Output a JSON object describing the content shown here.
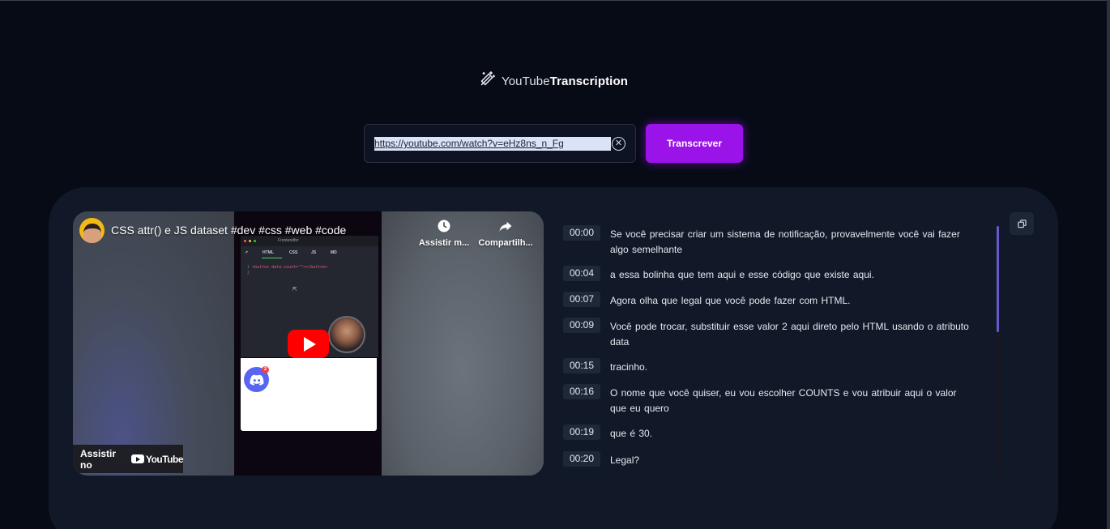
{
  "app": {
    "logo_prefix": "YouTube",
    "logo_suffix": "Transcription",
    "icon": "magic-wand-icon"
  },
  "search": {
    "url_value": "https://youtube.com/watch?v=eHz8ns_n_Fg",
    "clear_icon": "close-circle-icon",
    "submit_label": "Transcrever",
    "accent": "#9a13e8"
  },
  "video": {
    "title": "CSS attr() e JS dataset #dev #css #web #code",
    "watch_later_label": "Assistir m...",
    "share_label": "Compartilh...",
    "watch_on_label": "Assistir no",
    "youtube_wordmark": "YouTube",
    "thumbnail": {
      "editor_title": "Frontendfor",
      "tabs": [
        "HTML",
        "CSS",
        "JS",
        "MD"
      ],
      "code_line_1": "<button data-count=\"\"></button>",
      "discord_badge": "2"
    }
  },
  "transcript": [
    {
      "time": "00:00",
      "text": "Se você  precisar criar um  sistema de notificação,  provavelmente você vai  fazer algo semelhante"
    },
    {
      "time": "00:04",
      "text": "a essa  bolinha que tem  aqui e esse  código que existe  aqui."
    },
    {
      "time": "00:07",
      "text": "Agora olha  que legal que  você pode fazer  com HTML."
    },
    {
      "time": "00:09",
      "text": "Você pode  trocar, substituir esse  valor 2 aqui  direto pelo HTML  usando o  atributo  data"
    },
    {
      "time": "00:15",
      "text": "tracinho."
    },
    {
      "time": "00:16",
      "text": "O nome  que você quiser,  eu vou escolher  COUNTS e vou  atribuir aqui o  valor  que eu  quero"
    },
    {
      "time": "00:19",
      "text": "que é  30."
    },
    {
      "time": "00:20",
      "text": "Legal?"
    }
  ],
  "copy_icon": "copy-icon"
}
